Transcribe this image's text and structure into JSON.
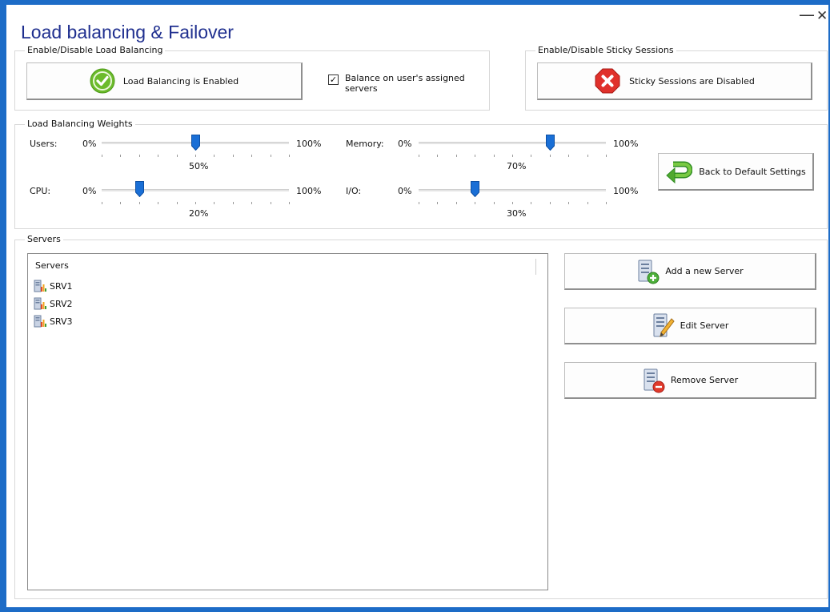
{
  "window": {
    "title": "Load balancing & Failover",
    "minimize_glyph": "—",
    "close_glyph": "✕"
  },
  "load_balancing": {
    "group_label": "Enable/Disable Load Balancing",
    "button_label": "Load Balancing is Enabled",
    "button_icon": "check-circle-icon",
    "checkbox_checked": true,
    "checkbox_glyph": "✓",
    "checkbox_label_line1": "Balance on user's assigned",
    "checkbox_label_line2": "servers"
  },
  "sticky": {
    "group_label": "Enable/Disable Sticky Sessions",
    "button_label": "Sticky Sessions are Disabled",
    "button_icon": "stop-x-icon"
  },
  "weights": {
    "group_label": "Load Balancing Weights",
    "min_label": "0%",
    "max_label": "100%",
    "sliders": [
      {
        "label": "Users:",
        "value": 50,
        "value_label": "50%"
      },
      {
        "label": "Memory:",
        "value": 70,
        "value_label": "70%"
      },
      {
        "label": "CPU:",
        "value": 20,
        "value_label": "20%"
      },
      {
        "label": "I/O:",
        "value": 30,
        "value_label": "30%"
      }
    ],
    "default_button_label": "Back to Default Settings",
    "default_button_icon": "return-arrow-icon"
  },
  "servers": {
    "group_label": "Servers",
    "list_header": "Servers",
    "items": [
      "SRV1",
      "SRV2",
      "SRV3"
    ],
    "add_label": "Add a new Server",
    "edit_label": "Edit Server",
    "remove_label": "Remove Server"
  },
  "colors": {
    "accent": "#1d6cc7",
    "title": "#1f2f8f",
    "slider_thumb": "#1a6fd6",
    "ok_green": "#6cbb2c",
    "stop_red": "#e0312b"
  }
}
